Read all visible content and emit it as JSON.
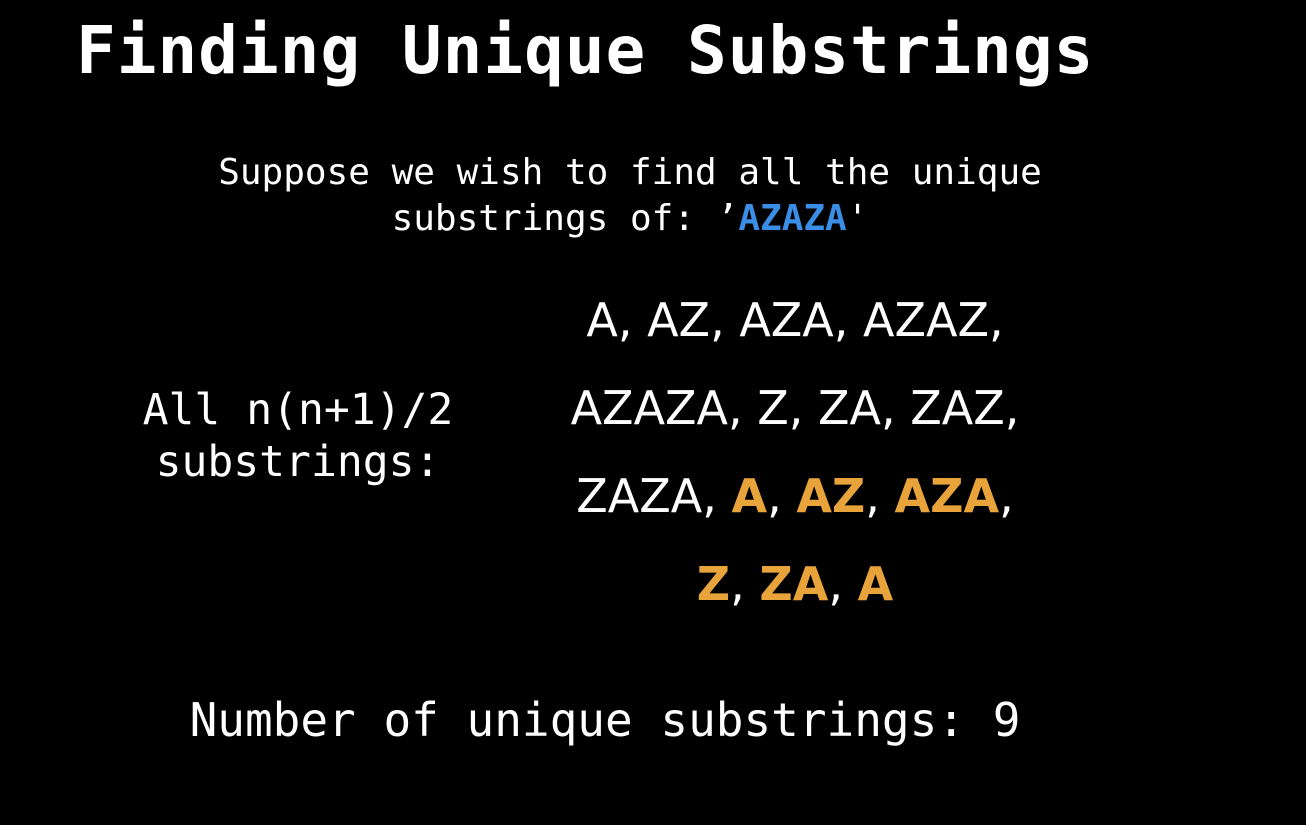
{
  "title": "Finding Unique Substrings",
  "intro": {
    "line1": "Suppose we wish to find all the unique",
    "line2_prefix": "substrings of: ’",
    "string": "AZAZA",
    "line2_suffix": "'"
  },
  "label": {
    "line1": "All n(n+1)/2",
    "line2": "substrings:"
  },
  "substrings": {
    "row1": [
      {
        "text": "A",
        "sep": ", "
      },
      {
        "text": "AZ",
        "sep": ", "
      },
      {
        "text": "AZA",
        "sep": ", "
      },
      {
        "text": "AZAZ",
        "sep": ","
      }
    ],
    "row2": [
      {
        "text": "AZAZA",
        "sep": ", "
      },
      {
        "text": "Z",
        "sep": ", "
      },
      {
        "text": "ZA",
        "sep": ", "
      },
      {
        "text": "ZAZ",
        "sep": ","
      }
    ],
    "row3": [
      {
        "text": "ZAZA",
        "sep": ", "
      },
      {
        "text": "A",
        "sep": ", "
      },
      {
        "text": "AZ",
        "sep": ", "
      },
      {
        "text": "AZA",
        "sep": ","
      }
    ],
    "row4": [
      {
        "text": "Z",
        "sep": ", "
      },
      {
        "text": "ZA",
        "sep": ", "
      },
      {
        "text": "A",
        "sep": ""
      }
    ]
  },
  "result": "Number of unique substrings: 9",
  "colors": {
    "background": "#000000",
    "text": "#ffffff",
    "highlight_string": "#3a8ee6",
    "duplicate": "#e8a43a"
  }
}
